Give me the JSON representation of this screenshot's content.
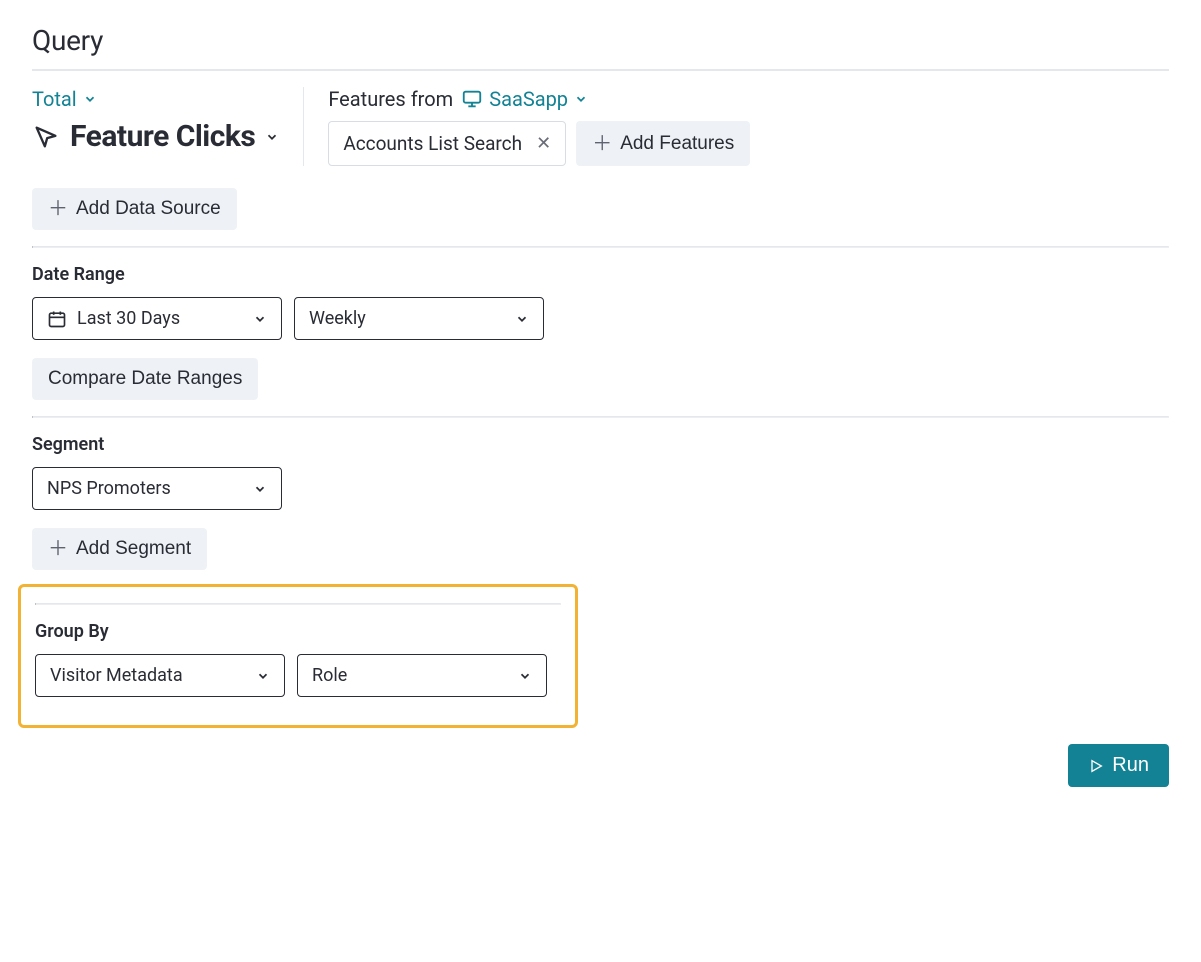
{
  "panel": {
    "title": "Query"
  },
  "aggregation": {
    "label": "Total"
  },
  "metric": {
    "title": "Feature Clicks"
  },
  "features": {
    "prefix": "Features from",
    "app": "SaaSapp",
    "chips": [
      {
        "label": "Accounts List Search"
      }
    ],
    "addLabel": "Add Features"
  },
  "dataSource": {
    "addLabel": "Add Data Source"
  },
  "dateRange": {
    "label": "Date Range",
    "range": "Last 30 Days",
    "granularity": "Weekly",
    "compareLabel": "Compare Date Ranges"
  },
  "segment": {
    "label": "Segment",
    "value": "NPS Promoters",
    "addLabel": "Add Segment"
  },
  "groupBy": {
    "label": "Group By",
    "type": "Visitor Metadata",
    "field": "Role"
  },
  "actions": {
    "run": "Run"
  }
}
